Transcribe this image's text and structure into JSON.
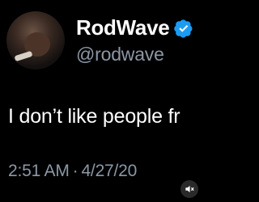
{
  "profile": {
    "display_name": "RodWave",
    "handle": "@rodwave",
    "verified_icon": "verified-badge-icon",
    "accent_color": "#1d9bf0"
  },
  "tweet": {
    "text": "I don’t like people fr",
    "time": "2:51 AM",
    "separator": "·",
    "date": "4/27/20"
  },
  "overlay": {
    "mute_icon": "speaker-muted-icon"
  }
}
